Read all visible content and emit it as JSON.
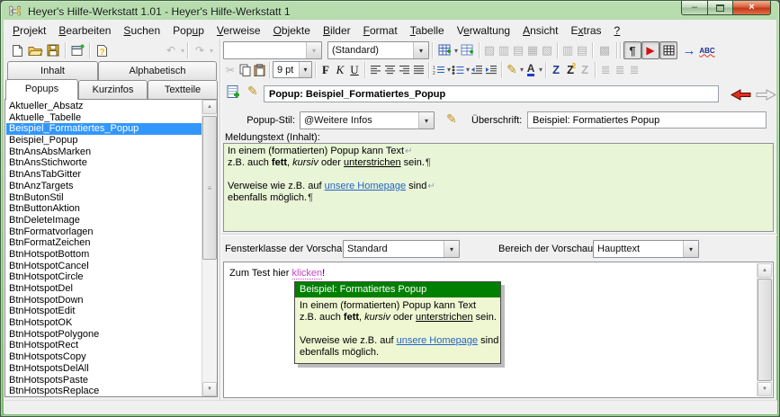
{
  "window": {
    "title": "Heyer's Hilfe-Werkstatt 1.01 - Heyer's Hilfe-Werkstatt 1",
    "minimize_glyph": "–",
    "close_glyph": "×"
  },
  "icons": {
    "dropdown": "▾",
    "undo": "↶",
    "redo": "↷",
    "pilcrow": "¶",
    "play": "▶",
    "blue_arrow": "→",
    "spellcheck": "ABC",
    "scissors": "✂",
    "pencil": "✎",
    "font_color_letter": "A",
    "scroll_up": "▲",
    "scroll_down": "▼",
    "thumb_grip": "≡",
    "help_mark": "?"
  },
  "menubar": {
    "items": [
      {
        "pre": "",
        "key": "P",
        "post": "rojekt"
      },
      {
        "pre": "",
        "key": "B",
        "post": "earbeiten"
      },
      {
        "pre": "",
        "key": "S",
        "post": "uchen"
      },
      {
        "pre": "Pop",
        "key": "u",
        "post": "p"
      },
      {
        "pre": "",
        "key": "V",
        "post": "erweise"
      },
      {
        "pre": "",
        "key": "O",
        "post": "bjekte"
      },
      {
        "pre": "",
        "key": "B",
        "post": "ilder"
      },
      {
        "pre": "",
        "key": "F",
        "post": "ormat"
      },
      {
        "pre": "",
        "key": "T",
        "post": "abelle"
      },
      {
        "pre": "V",
        "key": "e",
        "post": "rwaltung"
      },
      {
        "pre": "",
        "key": "A",
        "post": "nsicht"
      },
      {
        "pre": "E",
        "key": "x",
        "post": "tras"
      },
      {
        "pre": "",
        "key": "?",
        "post": ""
      }
    ]
  },
  "toolbars": {
    "para_combo_value": "",
    "format_combo_value": "(Standard)",
    "font_size_value": "9 pt",
    "bold": "F",
    "italic": "K",
    "underline": "U",
    "z_plain": "Z",
    "z_super": "Z",
    "z_super_badge": "2",
    "z_gray": "Z",
    "disabled_table_icons": [
      {
        "name": "edit-table-icon",
        "glyph": "▨"
      },
      {
        "name": "insert-column-icon",
        "glyph": "▥"
      },
      {
        "name": "delete-column-icon",
        "glyph": "▤"
      },
      {
        "name": "insert-row-icon",
        "glyph": "▦"
      },
      {
        "name": "delete-row-icon",
        "glyph": "▧"
      }
    ],
    "disabled_move_icons": [
      {
        "name": "move-column-icon",
        "glyph": "▥"
      },
      {
        "name": "move-row-icon",
        "glyph": "▤"
      }
    ],
    "disabled_search_icon_glyph": "▩",
    "disabled_paragraph_icons": [
      {
        "name": "paragraph-spacing-icon",
        "glyph": "≣"
      },
      {
        "name": "paragraph-marks-icon",
        "glyph": "≣"
      },
      {
        "name": "paragraph-compress-icon",
        "glyph": "≣"
      }
    ]
  },
  "sidebar": {
    "tabs_top": [
      "Inhalt",
      "Alphabetisch"
    ],
    "tabs_bottom": [
      "Popups",
      "Kurzinfos",
      "Textteile"
    ],
    "items": [
      "Aktueller_Absatz",
      "Aktuelle_Tabelle",
      "Beispiel_Formatiertes_Popup",
      "Beispiel_Popup",
      "BtnAnsAbsMarken",
      "BtnAnsStichworte",
      "BtnAnsTabGitter",
      "BtnAnzTargets",
      "BtnButonStil",
      "BtnButtonAktion",
      "BtnDeleteImage",
      "BtnFormatvorlagen",
      "BtnFormatZeichen",
      "BtnHotspotBottom",
      "BtnHotspotCancel",
      "BtnHotspotCircle",
      "BtnHotspotDel",
      "BtnHotspotDown",
      "BtnHotspotEdit",
      "BtnHotspotOK",
      "BtnHotspotPolygone",
      "BtnHotspotRect",
      "BtnHotspotsCopy",
      "BtnHotspotsDelAll",
      "BtnHotspotsPaste",
      "BtnHotspotsReplace"
    ],
    "selected_index": 2
  },
  "editor": {
    "bar_title": "Popup: Beispiel_Formatiertes_Popup",
    "style_label": "Popup-Stil:",
    "style_value": "@Weitere Infos",
    "heading_label": "Überschrift:",
    "heading_value": "Beispiel: Formatiertes Popup",
    "message_label": "Meldungstext (Inhalt):",
    "message_lines": [
      [
        {
          "t": "In einem (formatierten) Popup kann Text"
        },
        {
          "t": "↵",
          "mark": "softbreak"
        }
      ],
      [
        {
          "t": "z.B. auch "
        },
        {
          "t": "fett",
          "b": 1
        },
        {
          "t": ", "
        },
        {
          "t": "kursiv",
          "i": 1
        },
        {
          "t": " oder "
        },
        {
          "t": "unterstrichen",
          "u": 1
        },
        {
          "t": " sein."
        },
        {
          "t": "¶",
          "mark": "pilcrow-mark"
        }
      ],
      [],
      [
        {
          "t": "Verweise wie z.B. auf "
        },
        {
          "t": "unsere Homepage",
          "link": 1
        },
        {
          "t": " sind"
        },
        {
          "t": "↵",
          "mark": "softbreak"
        }
      ],
      [
        {
          "t": "ebenfalls möglich."
        },
        {
          "t": "¶",
          "mark": "pilcrow-mark"
        }
      ]
    ]
  },
  "preview": {
    "class_label": "Fensterklasse der Vorschau:",
    "class_value": "Standard",
    "region_label": "Bereich der Vorschau:",
    "region_value": "Haupttext",
    "test_line": [
      {
        "t": "Zum Test hier "
      },
      {
        "t": "klicken",
        "testlink": 1
      },
      {
        "t": "!"
      }
    ],
    "popup": {
      "title": "Beispiel: Formatiertes Popup",
      "lines": [
        [
          {
            "t": "In einem (formatierten) Popup kann Text"
          }
        ],
        [
          {
            "t": "z.B. auch "
          },
          {
            "t": "fett",
            "b": 1
          },
          {
            "t": ", "
          },
          {
            "t": "kursiv",
            "i": 1
          },
          {
            "t": " oder "
          },
          {
            "t": "unterstrichen",
            "u": 1
          },
          {
            "t": " sein."
          }
        ],
        [],
        [
          {
            "t": "Verweise wie z.B. auf "
          },
          {
            "t": "unsere Homepage",
            "link": 1
          },
          {
            "t": " sind"
          }
        ],
        [
          {
            "t": "ebenfalls möglich."
          }
        ]
      ]
    }
  },
  "colors": {
    "popup_header": "#008000",
    "editor_background": "#e9f5d7",
    "selection_blue": "#3297fd",
    "link_blue": "#2464c8",
    "test_link_magenta": "#c545c5",
    "window_green": "#7cba72"
  }
}
